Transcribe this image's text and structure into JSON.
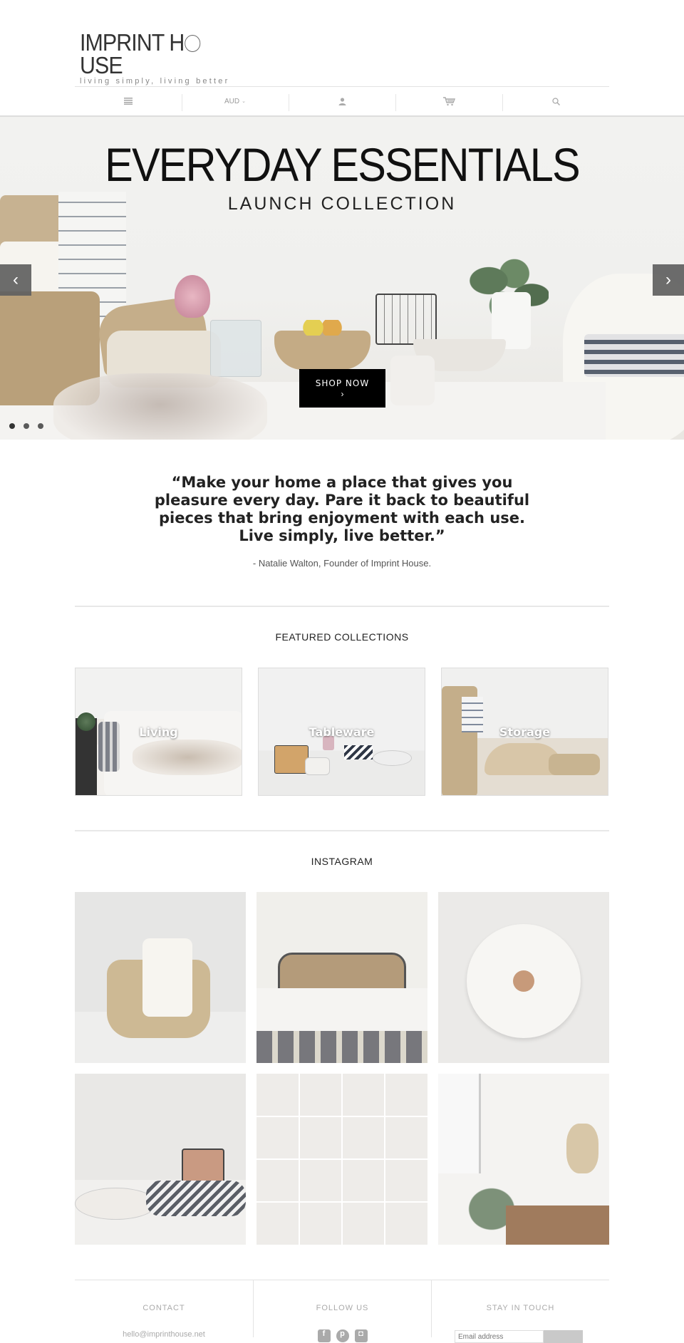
{
  "header": {
    "logo_text_1": "IMPRINT H",
    "logo_text_2": "USE",
    "logo_tagline": "living simply, living better",
    "nav": [
      {
        "icon": "menu-icon"
      },
      {
        "label": "AUD",
        "icon": "chevron-down-icon"
      },
      {
        "icon": "user-icon"
      },
      {
        "icon": "cart-icon"
      },
      {
        "icon": "search-icon"
      }
    ]
  },
  "hero": {
    "title": "EVERYDAY ESSENTIALS",
    "subtitle": "LAUNCH COLLECTION",
    "cta_label": "SHOP NOW",
    "cta_chevron": "›",
    "prev_glyph": "‹",
    "next_glyph": "›",
    "slides": 3,
    "active_slide": 1
  },
  "quote": {
    "text": "“Make your home a place that gives you pleasure every day. Pare it back to beautiful pieces that bring enjoyment with each use. Live simply, live better.”",
    "attribution": "- Natalie Walton, Founder of Imprint House."
  },
  "featured": {
    "title": "FEATURED COLLECTIONS",
    "items": [
      {
        "label": "Living"
      },
      {
        "label": "Tableware"
      },
      {
        "label": "Storage"
      }
    ]
  },
  "instagram": {
    "title": "INSTAGRAM",
    "posts": [
      {
        "subject": "woven basket with tassel throw"
      },
      {
        "subject": "bed with rattan headboard"
      },
      {
        "subject": "white enamel pot with wooden knob"
      },
      {
        "subject": "wire basket with eggs and striped cloth"
      },
      {
        "subject": "grid of wooden objects"
      },
      {
        "subject": "dining chairs with eucalyptus and peg rail"
      }
    ]
  },
  "footer": {
    "contact_title": "CONTACT",
    "contact_email": "hello@imprinthouse.net",
    "follow_title": "FOLLOW US",
    "social": [
      "facebook-icon",
      "pinterest-icon",
      "instagram-icon"
    ],
    "stay_title": "STAY IN TOUCH",
    "email_placeholder": "Email address",
    "subscribe_label": ""
  },
  "colors": {
    "text": "#222222",
    "muted": "#aaaaaa",
    "cta_bg": "#000000",
    "arrow_bg": "#5f5f5f"
  }
}
